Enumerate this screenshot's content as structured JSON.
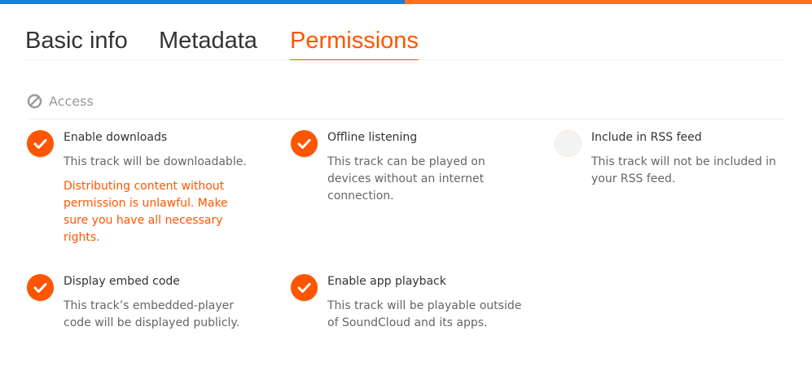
{
  "colors": {
    "accent": "#ff5500",
    "top_bar_blue": "#1a7fd4",
    "top_bar_orange": "#ff6f1c"
  },
  "tabs": [
    {
      "label": "Basic info",
      "active": false
    },
    {
      "label": "Metadata",
      "active": false
    },
    {
      "label": "Permissions",
      "active": true
    }
  ],
  "access": {
    "label": "Access",
    "icon": "ban-icon"
  },
  "permissions": [
    {
      "title": "Enable downloads",
      "description": "This track will be downloadable.",
      "warning": "Distributing content without permission is unlawful. Make sure you have all necessary rights.",
      "checked": true
    },
    {
      "title": "Offline listening",
      "description": "This track can be played on devices without an internet connection.",
      "checked": true
    },
    {
      "title": "Include in RSS feed",
      "description": "This track will not be included in your RSS feed.",
      "checked": false
    },
    {
      "title": "Display embed code",
      "description": "This track’s embedded-player code will be displayed publicly.",
      "checked": true
    },
    {
      "title": "Enable app playback",
      "description": "This track will be playable outside of SoundCloud and its apps.",
      "checked": true
    }
  ]
}
